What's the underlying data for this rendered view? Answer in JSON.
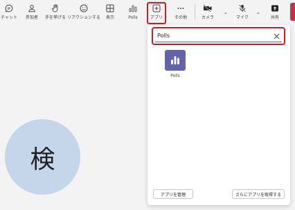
{
  "toolbar": {
    "chat": "チャット",
    "participants": "参加者",
    "raise_hand": "手を挙げる",
    "react": "リアクションする",
    "view": "表示",
    "polls": "Polls",
    "apps": "アプリ",
    "more": "その他",
    "camera": "カメラ",
    "mic": "マイク",
    "share": "共有"
  },
  "avatar": {
    "initial": "検"
  },
  "flyout": {
    "search_value": "Polls",
    "apps": [
      {
        "name": "Polls",
        "icon": "polls-icon",
        "color": "#6264a7"
      }
    ],
    "manage_button": "アプリを管理",
    "get_more_button": "さらにアプリを取得する"
  },
  "colors": {
    "highlight": "#d11a1a",
    "accent": "#6264a7",
    "avatar_bg": "#c5d5ea",
    "leave_red": "#c4314b"
  }
}
